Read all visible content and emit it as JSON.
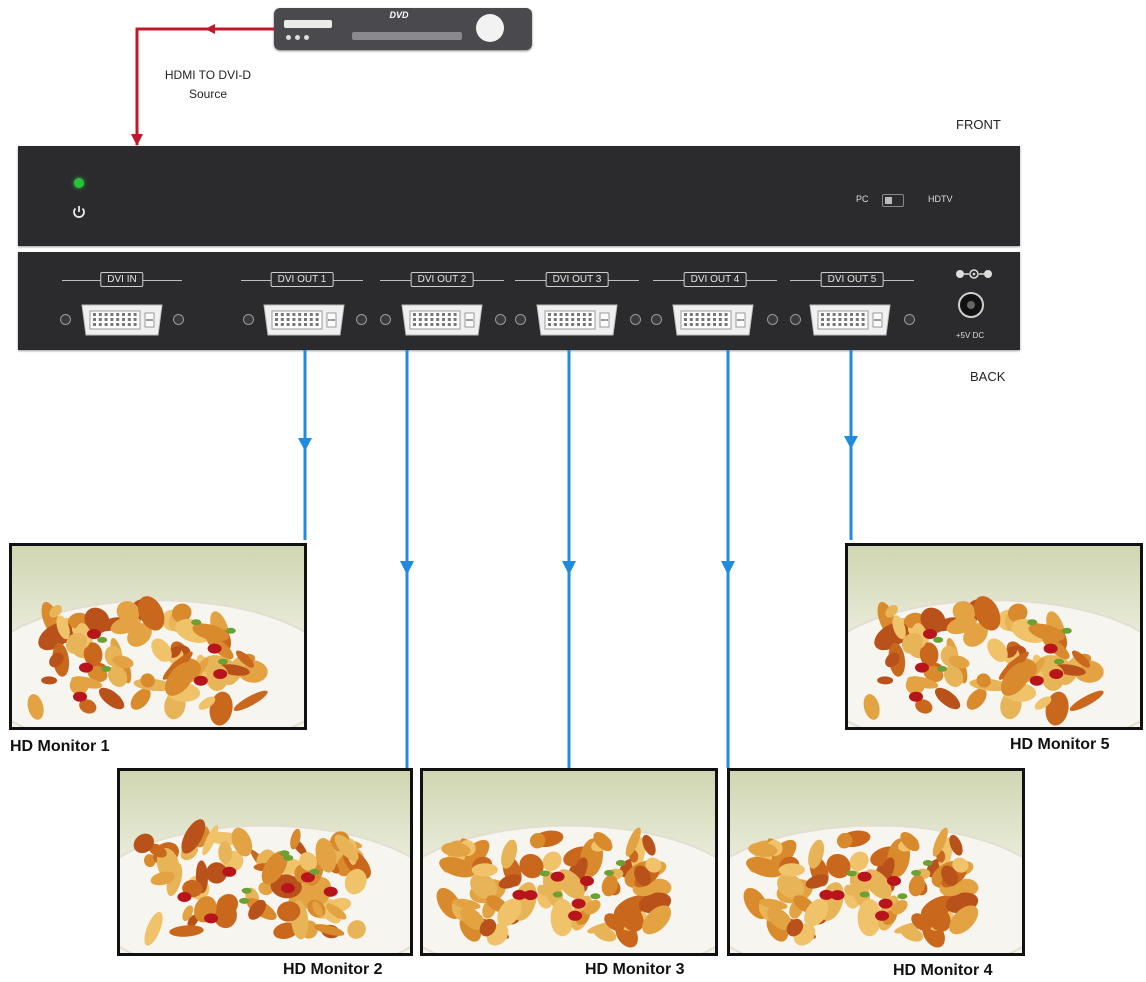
{
  "source": {
    "device_label": "DVD",
    "cable_label_line1": "HDMI TO DVI-D",
    "cable_label_line2": "Source"
  },
  "front_panel": {
    "side_label": "FRONT",
    "switch_left": "PC",
    "switch_right": "HDTV"
  },
  "back_panel": {
    "side_label": "BACK",
    "input_label": "DVI IN",
    "outputs": [
      "DVI OUT 1",
      "DVI OUT 2",
      "DVI OUT 3",
      "DVI OUT 4",
      "DVI OUT 5"
    ],
    "power_label": "+5V DC"
  },
  "monitors": [
    "HD Monitor 1",
    "HD Monitor 2",
    "HD Monitor 3",
    "HD Monitor 4",
    "HD Monitor 5"
  ],
  "colors": {
    "source_cable": "#c0182b",
    "output_cable": "#1f8ce0",
    "unit_body": "#2b2b2d",
    "power_led": "#27c23c"
  }
}
